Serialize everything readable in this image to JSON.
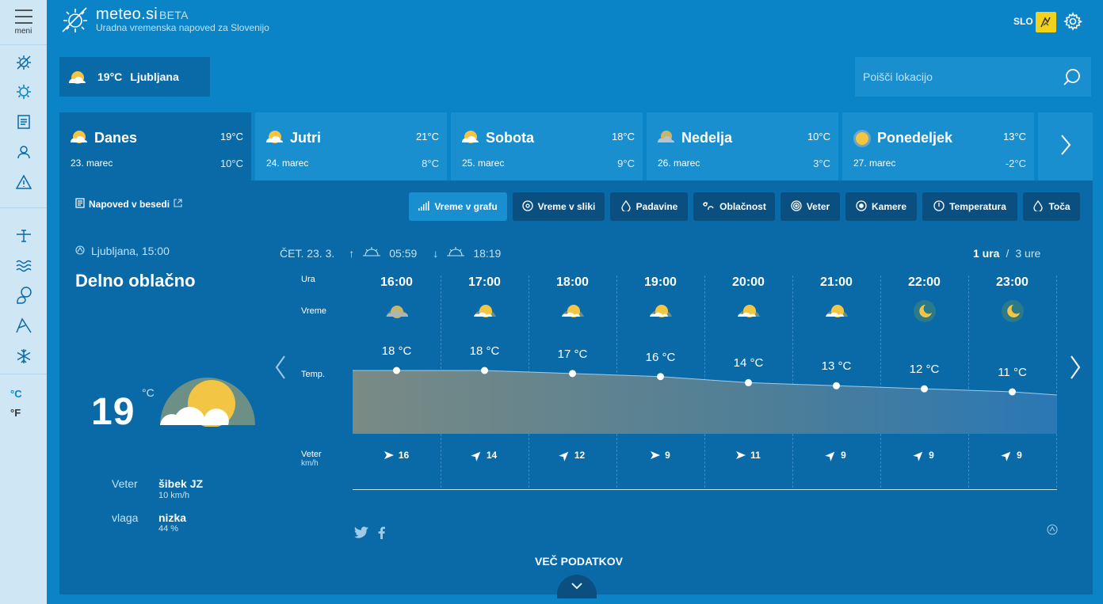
{
  "sidebar": {
    "menu_label": "meni",
    "icons": [
      "sun-cloud-icon",
      "sun-icon",
      "document-icon",
      "user-icon",
      "warning-icon",
      "plane-icon",
      "waves-icon",
      "weather-balloon-icon",
      "mountain-icon",
      "snowflake-icon"
    ],
    "units": [
      "°C",
      "°F"
    ],
    "active_unit": "°C"
  },
  "header": {
    "title": "meteo.si",
    "badge": "BETA",
    "subtitle": "Uradna vremenska napoved za Slovenijo",
    "language": "SLO"
  },
  "location_box": {
    "temp": "19°C",
    "name": "Ljubljana"
  },
  "search": {
    "placeholder": "Poišči lokacijo"
  },
  "days": [
    {
      "name": "Danes",
      "date": "23. marec",
      "high": "19°C",
      "low": "10°C",
      "icon": "sun-cloud-icon",
      "active": true
    },
    {
      "name": "Jutri",
      "date": "24. marec",
      "high": "21°C",
      "low": "8°C",
      "icon": "sun-cloud-icon"
    },
    {
      "name": "Sobota",
      "date": "25. marec",
      "high": "18°C",
      "low": "9°C",
      "icon": "sun-cloud-icon"
    },
    {
      "name": "Nedelja",
      "date": "26. marec",
      "high": "10°C",
      "low": "3°C",
      "icon": "rain-cloud-icon"
    },
    {
      "name": "Ponedeljek",
      "date": "27. marec",
      "high": "13°C",
      "low": "-2°C",
      "icon": "sun-icon"
    }
  ],
  "panel": {
    "besedi_label": "Napoved v besedi",
    "tabs": [
      "Vreme v grafu",
      "Vreme v sliki",
      "Padavine",
      "Oblačnost",
      "Veter",
      "Kamere",
      "Temperatura",
      "Toča"
    ],
    "place": "Ljubljana, 15:00",
    "condition": "Delno oblačno",
    "temp": "19",
    "temp_unit": "°C",
    "wind_label": "Veter",
    "wind_value": "šibek JZ",
    "wind_speed": "10 km/h",
    "humidity_label": "vlaga",
    "humidity_value": "nizka",
    "humidity_pct": "44 %",
    "date": "ČET. 23. 3.",
    "sunrise": "05:59",
    "sunset": "18:19",
    "interval_selected": "1 ura",
    "interval_other": "3 ure",
    "row_labels": {
      "hour": "Ura",
      "weather": "Vreme",
      "temp": "Temp.",
      "wind": "Veter",
      "wind_unit": "km/h"
    },
    "more_label": "VEČ PODATKOV"
  },
  "chart_data": {
    "type": "area",
    "x": [
      "16:00",
      "17:00",
      "18:00",
      "19:00",
      "20:00",
      "21:00",
      "22:00",
      "23:00"
    ],
    "series": [
      {
        "values": [
          18,
          18,
          17,
          16,
          14,
          13,
          12,
          11
        ]
      }
    ],
    "temp_labels": [
      "18 °C",
      "18 °C",
      "17 °C",
      "16 °C",
      "14 °C",
      "13 °C",
      "12 °C",
      "11 °C"
    ],
    "wind_speed": [
      16,
      14,
      12,
      9,
      11,
      9,
      9,
      9
    ],
    "wind_direction": [
      "E",
      "NE",
      "NE",
      "E",
      "E",
      "NE",
      "NE",
      "NE"
    ],
    "weather_icons": [
      "cloudy-icon",
      "sun-cloud-icon",
      "sun-cloud-icon",
      "sun-cloud-icon",
      "sun-cloud-icon",
      "sun-cloud-icon",
      "moon-icon",
      "moon-icon"
    ]
  }
}
